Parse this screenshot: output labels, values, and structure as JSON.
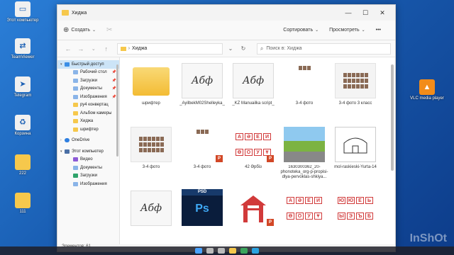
{
  "desktop": {
    "icons_left": [
      {
        "label": "Этот компьютер",
        "icon": "pc-icon"
      },
      {
        "label": "TeamViewer",
        "icon": "teamviewer-icon"
      },
      {
        "label": "Telegram",
        "icon": "telegram-icon"
      },
      {
        "label": "Корзина",
        "icon": "recycle-bin-icon"
      },
      {
        "label": "222",
        "icon": "folder-icon"
      },
      {
        "label": "111",
        "icon": "folder-icon"
      }
    ],
    "icons_right": [
      {
        "label": "VLC media player",
        "icon": "vlc-icon"
      }
    ],
    "watermark": "InShOt"
  },
  "window": {
    "title": "Хиджа",
    "minimize": "—",
    "maximize": "☐",
    "close": "✕"
  },
  "toolbar": {
    "create_label": "Создать",
    "sort_label": "Сортировать",
    "view_label": "Просмотреть",
    "more_label": "•••"
  },
  "address": {
    "path": "Хиджа",
    "search_placeholder": "Поиск в: Хиджа"
  },
  "navpane": {
    "items": [
      {
        "label": "Быстрый доступ",
        "level": 0,
        "icon": "star-icon",
        "selected": true
      },
      {
        "label": "Рабочий стол",
        "level": 1,
        "icon": "desktop-folder-icon",
        "pinned": true
      },
      {
        "label": "Загрузки",
        "level": 1,
        "icon": "downloads-icon",
        "pinned": true
      },
      {
        "label": "Документы",
        "level": 1,
        "icon": "documents-icon",
        "pinned": true
      },
      {
        "label": "Изображения",
        "level": 1,
        "icon": "images-icon",
        "pinned": true
      },
      {
        "label": "ру4 конвертац",
        "level": 1,
        "icon": "folder-icon"
      },
      {
        "label": "Альбом камеры",
        "level": 1,
        "icon": "folder-icon"
      },
      {
        "label": "Хиджа",
        "level": 1,
        "icon": "folder-icon"
      },
      {
        "label": "шрифтер",
        "level": 1,
        "icon": "folder-icon"
      },
      {
        "label": "OneDrive",
        "level": 0,
        "icon": "cloud-icon"
      },
      {
        "label": "Этот компьютер",
        "level": 0,
        "icon": "pc-icon"
      },
      {
        "label": "Видео",
        "level": 1,
        "icon": "video-icon"
      },
      {
        "label": "Документы",
        "level": 1,
        "icon": "documents-icon"
      },
      {
        "label": "Загрузки",
        "level": 1,
        "icon": "downloads-icon"
      },
      {
        "label": "Изображения",
        "level": 1,
        "icon": "images-icon"
      }
    ]
  },
  "files": [
    {
      "name": "шрифтер",
      "kind": "folder"
    },
    {
      "name": "_AyilbekM02Shelleyka_",
      "kind": "script",
      "glyph": "Абф"
    },
    {
      "name": "_KZ Manuailka script_",
      "kind": "script",
      "glyph": "Абф"
    },
    {
      "name": "3-4 фото",
      "kind": "photos-small"
    },
    {
      "name": "3-4 фото 3 класс",
      "kind": "photos"
    },
    {
      "name": "3-4 фото",
      "kind": "photos"
    },
    {
      "name": "3-4 фото",
      "kind": "photos-small-ppt"
    },
    {
      "name": "42 Əрбіз",
      "kind": "letters-ppt",
      "letters": [
        "А",
        "Ә",
        "Е",
        "И",
        "Ө",
        "О",
        "У",
        "Ұ"
      ]
    },
    {
      "name": "1630300362_20-phonoteka_org-p-propisi-dlya-pervoklas-shkiya...",
      "kind": "street"
    },
    {
      "name": "mol-raskieski-Yurta-14",
      "kind": "sketch"
    },
    {
      "name": "",
      "kind": "script",
      "glyph": "Абф"
    },
    {
      "name": "",
      "kind": "psd",
      "tag": "PSD",
      "text": "Ps"
    },
    {
      "name": "",
      "kind": "house"
    },
    {
      "name": "",
      "kind": "letters",
      "letters": [
        "А",
        "Ә",
        "Е",
        "И",
        "Ө",
        "О",
        "У",
        "Ұ"
      ]
    },
    {
      "name": "",
      "kind": "letters",
      "letters": [
        "Ю",
        "Ю",
        "Е",
        "Ь",
        "Ы",
        "Э",
        "Ъ",
        "Б"
      ]
    }
  ],
  "status": {
    "count": "Элементов: 61"
  },
  "colors": {
    "accent": "#0067c0",
    "folder": "#f6c84c",
    "red_letter": "#d13a3a",
    "ppt": "#d24726"
  }
}
